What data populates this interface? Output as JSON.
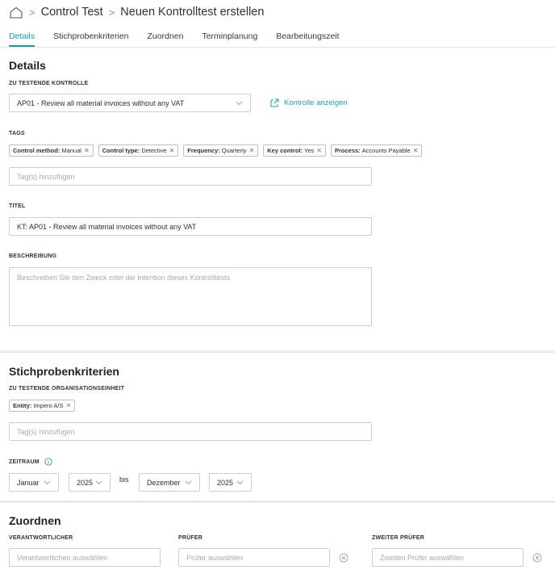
{
  "breadcrumb": {
    "home_icon": "home-icon",
    "sep": ">",
    "items": [
      "Control Test",
      "Neuen Kontrolltest erstellen"
    ]
  },
  "tabs": [
    {
      "label": "Details",
      "active": true
    },
    {
      "label": "Stichprobenkriterien",
      "active": false
    },
    {
      "label": "Zuordnen",
      "active": false
    },
    {
      "label": "Terminplanung",
      "active": false
    },
    {
      "label": "Bearbeitungszeit",
      "active": false
    }
  ],
  "details": {
    "title": "Details",
    "control_label": "ZU TESTENDE KONTROLLE",
    "control_value": "AP01 - Review all material invoices without any VAT",
    "show_control_link": "Kontrolle anzeigen",
    "tags_label": "TAGS",
    "tags": [
      {
        "key": "Control method:",
        "value": "Manual"
      },
      {
        "key": "Control type:",
        "value": "Detective"
      },
      {
        "key": "Frequency:",
        "value": "Quarterly"
      },
      {
        "key": "Key control:",
        "value": "Yes"
      },
      {
        "key": "Process:",
        "value": "Accounts Payable"
      }
    ],
    "tag_add_placeholder": "Tag(s) hinzufügen",
    "title_label": "TITEL",
    "title_value": "KT: AP01 - Review all material invoices without any VAT",
    "description_label": "BESCHREIBUNG",
    "description_placeholder": "Beschreiben Sie den Zweck oder die Intention dieses Kontrolltests"
  },
  "sampling": {
    "title": "Stichprobenkriterien",
    "org_label": "ZU TESTENDE ORGANISATIONSEINHEIT",
    "org_tag": {
      "key": "Entity:",
      "value": "Impero A/S"
    },
    "tag_add_placeholder": "Tag(s) hinzufügen",
    "period_label": "ZEITRAUM",
    "from_month": "Januar",
    "from_year": "2025",
    "to_word": "bis",
    "to_month": "Dezember",
    "to_year": "2025"
  },
  "assign": {
    "title": "Zuordnen",
    "responsible_label": "VERANTWORTLICHER",
    "responsible_placeholder": "Verantwortlichen auswählen",
    "reviewer_label": "PRÜFER",
    "reviewer_placeholder": "Prüfer auswählen",
    "second_reviewer_label": "ZWEITER PRÜFER",
    "second_reviewer_placeholder": "Zweiten Prüfer auswählen"
  },
  "colors": {
    "accent": "#139e9c",
    "border": "#c9cfd3",
    "divider": "#e8ebed"
  }
}
